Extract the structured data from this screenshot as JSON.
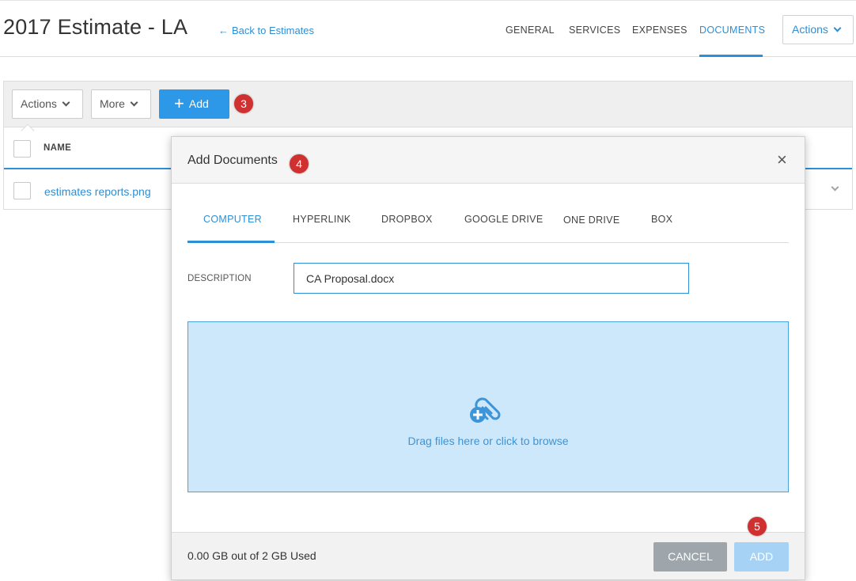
{
  "header": {
    "title": "2017 Estimate - LA",
    "back_arrow": "←",
    "back_link": "Back to Estimates",
    "nav": [
      "GENERAL",
      "SERVICES",
      "EXPENSES",
      "DOCUMENTS"
    ],
    "active_nav": "DOCUMENTS",
    "actions_label": "Actions"
  },
  "toolbar": {
    "actions_label": "Actions",
    "more_label": "More",
    "add_plus": "+",
    "add_label": "Add"
  },
  "table": {
    "column_name": "NAME",
    "rows": [
      {
        "name": "estimates reports.png"
      }
    ]
  },
  "badges": [
    "3",
    "4",
    "5"
  ],
  "modal": {
    "title": "Add Documents",
    "close_glyph": "×",
    "tabs": [
      "COMPUTER",
      "HYPERLINK",
      "DROPBOX",
      "GOOGLE DRIVE",
      "ONE DRIVE",
      "BOX"
    ],
    "active_tab": "COMPUTER",
    "description_label": "DESCRIPTION",
    "description_value": "CA Proposal.docx",
    "drop_text": "Drag files here or click to browse",
    "usage_text": "0.00 GB out of 2 GB Used",
    "cancel_label": "CANCEL",
    "add_label": "ADD"
  },
  "colors": {
    "accent": "#2d8fd5",
    "add_button": "#2d97e8",
    "badge": "#d0302f",
    "dropzone_bg": "#cde7fb",
    "cancel_bg": "#9ea6ab",
    "add_disabled_bg": "#a6d3f5"
  },
  "icons": {
    "back": "arrow-left-icon",
    "dropdown": "chevron-down-icon",
    "close": "close-icon",
    "dropzone": "paperclip-add-icon",
    "row_expand": "chevron-down-icon"
  }
}
